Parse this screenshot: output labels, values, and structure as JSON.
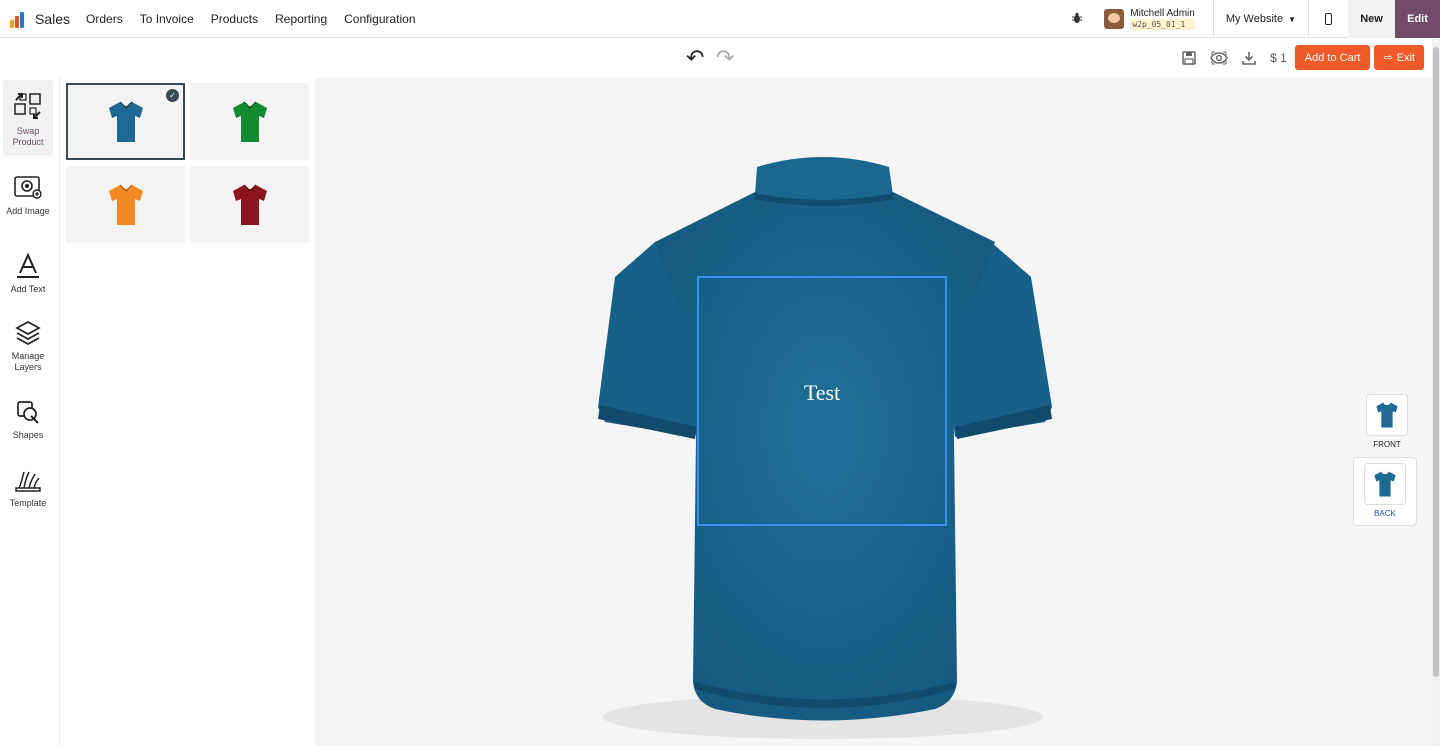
{
  "app": {
    "name": "Sales",
    "icon": "sales-chart-icon",
    "menu": [
      "Orders",
      "To Invoice",
      "Products",
      "Reporting",
      "Configuration"
    ]
  },
  "user": {
    "name": "Mitchell Admin",
    "db": "w2p_05_01_1"
  },
  "website": {
    "label": "My Website"
  },
  "nav_buttons": {
    "new": "New",
    "edit": "Edit"
  },
  "toolbar": {
    "price": "$ 1",
    "add_to_cart": "Add to Cart",
    "exit": "Exit"
  },
  "tools": [
    {
      "label": "Swap Product",
      "icon": "swap-product-icon",
      "active": true
    },
    {
      "label": "Add Image",
      "icon": "add-image-icon"
    },
    {
      "label": "Add Text",
      "icon": "add-text-icon"
    },
    {
      "label": "Manage Layers",
      "icon": "layers-icon"
    },
    {
      "label": "Shapes",
      "icon": "shapes-icon"
    },
    {
      "label": "Template",
      "icon": "template-icon"
    }
  ],
  "products": [
    {
      "color_name": "blue",
      "color": "#1f6a94",
      "selected": true
    },
    {
      "color_name": "green",
      "color": "#128a32"
    },
    {
      "color_name": "orange",
      "color": "#f28a24"
    },
    {
      "color_name": "maroon",
      "color": "#8a1620"
    }
  ],
  "canvas": {
    "shirt_color": "#1d6a93",
    "design_text": "Test",
    "design_box_color": "#3d8ff0"
  },
  "views": [
    {
      "label": "FRONT",
      "active": false
    },
    {
      "label": "BACK",
      "active": true
    }
  ],
  "colors": {
    "accent": "#f05a28",
    "brand": "#714b67"
  }
}
